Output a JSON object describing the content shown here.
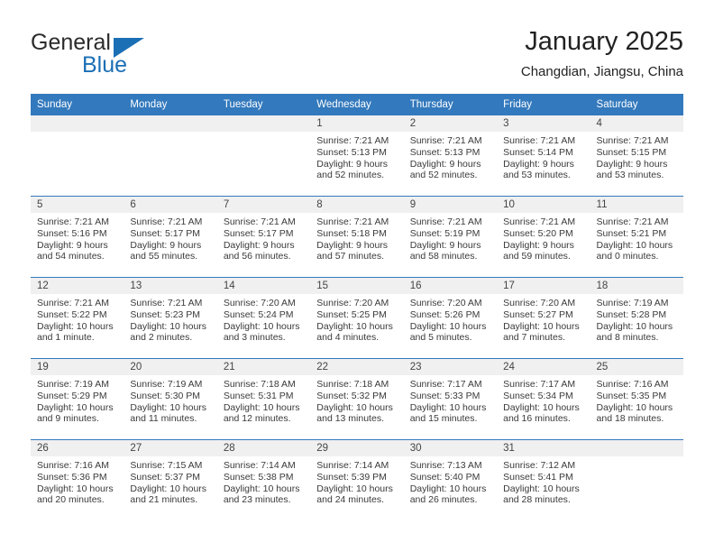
{
  "brand": {
    "name_top": "General",
    "name_bottom": "Blue",
    "accent_color": "#1b6fb5"
  },
  "header": {
    "title": "January 2025",
    "subtitle": "Changdian, Jiangsu, China"
  },
  "calendar": {
    "header_bg": "#3379bd",
    "daynum_bg": "#f0f0f0",
    "weekday_headers": [
      "Sunday",
      "Monday",
      "Tuesday",
      "Wednesday",
      "Thursday",
      "Friday",
      "Saturday"
    ],
    "weeks": [
      [
        {
          "day": "",
          "sunrise": "",
          "sunset": "",
          "daylight": "",
          "blank": true
        },
        {
          "day": "",
          "sunrise": "",
          "sunset": "",
          "daylight": "",
          "blank": true
        },
        {
          "day": "",
          "sunrise": "",
          "sunset": "",
          "daylight": "",
          "blank": true
        },
        {
          "day": "1",
          "sunrise": "Sunrise: 7:21 AM",
          "sunset": "Sunset: 5:13 PM",
          "daylight": "Daylight: 9 hours and 52 minutes."
        },
        {
          "day": "2",
          "sunrise": "Sunrise: 7:21 AM",
          "sunset": "Sunset: 5:13 PM",
          "daylight": "Daylight: 9 hours and 52 minutes."
        },
        {
          "day": "3",
          "sunrise": "Sunrise: 7:21 AM",
          "sunset": "Sunset: 5:14 PM",
          "daylight": "Daylight: 9 hours and 53 minutes."
        },
        {
          "day": "4",
          "sunrise": "Sunrise: 7:21 AM",
          "sunset": "Sunset: 5:15 PM",
          "daylight": "Daylight: 9 hours and 53 minutes."
        }
      ],
      [
        {
          "day": "5",
          "sunrise": "Sunrise: 7:21 AM",
          "sunset": "Sunset: 5:16 PM",
          "daylight": "Daylight: 9 hours and 54 minutes."
        },
        {
          "day": "6",
          "sunrise": "Sunrise: 7:21 AM",
          "sunset": "Sunset: 5:17 PM",
          "daylight": "Daylight: 9 hours and 55 minutes."
        },
        {
          "day": "7",
          "sunrise": "Sunrise: 7:21 AM",
          "sunset": "Sunset: 5:17 PM",
          "daylight": "Daylight: 9 hours and 56 minutes."
        },
        {
          "day": "8",
          "sunrise": "Sunrise: 7:21 AM",
          "sunset": "Sunset: 5:18 PM",
          "daylight": "Daylight: 9 hours and 57 minutes."
        },
        {
          "day": "9",
          "sunrise": "Sunrise: 7:21 AM",
          "sunset": "Sunset: 5:19 PM",
          "daylight": "Daylight: 9 hours and 58 minutes."
        },
        {
          "day": "10",
          "sunrise": "Sunrise: 7:21 AM",
          "sunset": "Sunset: 5:20 PM",
          "daylight": "Daylight: 9 hours and 59 minutes."
        },
        {
          "day": "11",
          "sunrise": "Sunrise: 7:21 AM",
          "sunset": "Sunset: 5:21 PM",
          "daylight": "Daylight: 10 hours and 0 minutes."
        }
      ],
      [
        {
          "day": "12",
          "sunrise": "Sunrise: 7:21 AM",
          "sunset": "Sunset: 5:22 PM",
          "daylight": "Daylight: 10 hours and 1 minute."
        },
        {
          "day": "13",
          "sunrise": "Sunrise: 7:21 AM",
          "sunset": "Sunset: 5:23 PM",
          "daylight": "Daylight: 10 hours and 2 minutes."
        },
        {
          "day": "14",
          "sunrise": "Sunrise: 7:20 AM",
          "sunset": "Sunset: 5:24 PM",
          "daylight": "Daylight: 10 hours and 3 minutes."
        },
        {
          "day": "15",
          "sunrise": "Sunrise: 7:20 AM",
          "sunset": "Sunset: 5:25 PM",
          "daylight": "Daylight: 10 hours and 4 minutes."
        },
        {
          "day": "16",
          "sunrise": "Sunrise: 7:20 AM",
          "sunset": "Sunset: 5:26 PM",
          "daylight": "Daylight: 10 hours and 5 minutes."
        },
        {
          "day": "17",
          "sunrise": "Sunrise: 7:20 AM",
          "sunset": "Sunset: 5:27 PM",
          "daylight": "Daylight: 10 hours and 7 minutes."
        },
        {
          "day": "18",
          "sunrise": "Sunrise: 7:19 AM",
          "sunset": "Sunset: 5:28 PM",
          "daylight": "Daylight: 10 hours and 8 minutes."
        }
      ],
      [
        {
          "day": "19",
          "sunrise": "Sunrise: 7:19 AM",
          "sunset": "Sunset: 5:29 PM",
          "daylight": "Daylight: 10 hours and 9 minutes."
        },
        {
          "day": "20",
          "sunrise": "Sunrise: 7:19 AM",
          "sunset": "Sunset: 5:30 PM",
          "daylight": "Daylight: 10 hours and 11 minutes."
        },
        {
          "day": "21",
          "sunrise": "Sunrise: 7:18 AM",
          "sunset": "Sunset: 5:31 PM",
          "daylight": "Daylight: 10 hours and 12 minutes."
        },
        {
          "day": "22",
          "sunrise": "Sunrise: 7:18 AM",
          "sunset": "Sunset: 5:32 PM",
          "daylight": "Daylight: 10 hours and 13 minutes."
        },
        {
          "day": "23",
          "sunrise": "Sunrise: 7:17 AM",
          "sunset": "Sunset: 5:33 PM",
          "daylight": "Daylight: 10 hours and 15 minutes."
        },
        {
          "day": "24",
          "sunrise": "Sunrise: 7:17 AM",
          "sunset": "Sunset: 5:34 PM",
          "daylight": "Daylight: 10 hours and 16 minutes."
        },
        {
          "day": "25",
          "sunrise": "Sunrise: 7:16 AM",
          "sunset": "Sunset: 5:35 PM",
          "daylight": "Daylight: 10 hours and 18 minutes."
        }
      ],
      [
        {
          "day": "26",
          "sunrise": "Sunrise: 7:16 AM",
          "sunset": "Sunset: 5:36 PM",
          "daylight": "Daylight: 10 hours and 20 minutes."
        },
        {
          "day": "27",
          "sunrise": "Sunrise: 7:15 AM",
          "sunset": "Sunset: 5:37 PM",
          "daylight": "Daylight: 10 hours and 21 minutes."
        },
        {
          "day": "28",
          "sunrise": "Sunrise: 7:14 AM",
          "sunset": "Sunset: 5:38 PM",
          "daylight": "Daylight: 10 hours and 23 minutes."
        },
        {
          "day": "29",
          "sunrise": "Sunrise: 7:14 AM",
          "sunset": "Sunset: 5:39 PM",
          "daylight": "Daylight: 10 hours and 24 minutes."
        },
        {
          "day": "30",
          "sunrise": "Sunrise: 7:13 AM",
          "sunset": "Sunset: 5:40 PM",
          "daylight": "Daylight: 10 hours and 26 minutes."
        },
        {
          "day": "31",
          "sunrise": "Sunrise: 7:12 AM",
          "sunset": "Sunset: 5:41 PM",
          "daylight": "Daylight: 10 hours and 28 minutes."
        },
        {
          "day": "",
          "sunrise": "",
          "sunset": "",
          "daylight": "",
          "blank": true
        }
      ]
    ]
  }
}
